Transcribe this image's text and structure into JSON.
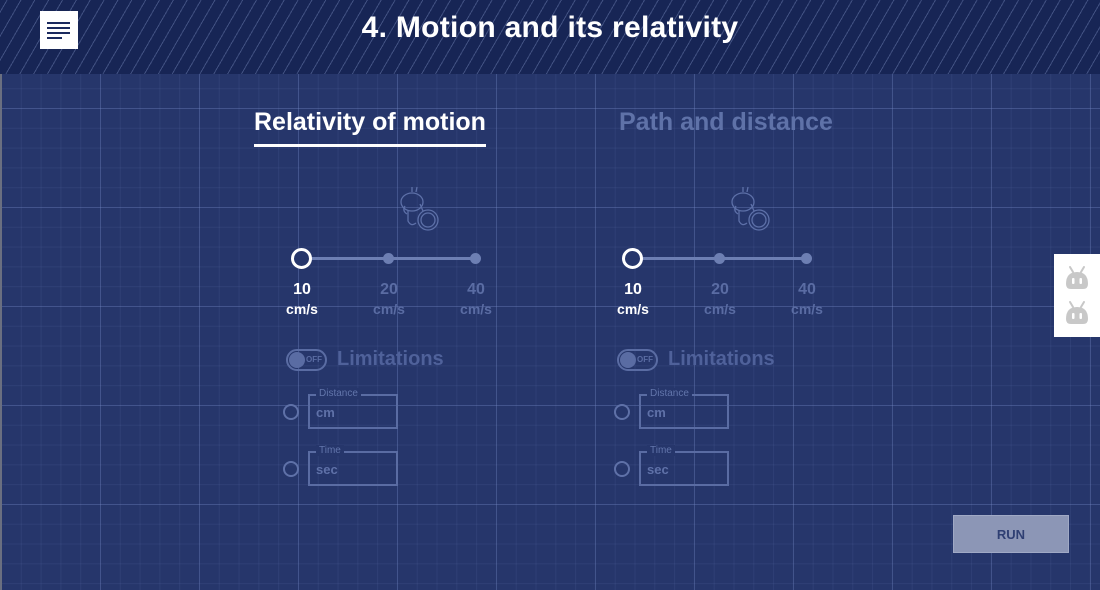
{
  "header": {
    "title": "4. Motion and its relativity",
    "menu_icon": "menu-lines-icon"
  },
  "tabs": [
    {
      "label": "Relativity of motion",
      "active": true
    },
    {
      "label": "Path and distance",
      "active": false
    }
  ],
  "panels": [
    {
      "robot_icon": "robot-icon",
      "speed_slider": {
        "stops": [
          {
            "value": "10",
            "unit": "cm/s"
          },
          {
            "value": "20",
            "unit": "cm/s"
          },
          {
            "value": "40",
            "unit": "cm/s"
          }
        ],
        "selected_index": 0
      },
      "limitations": {
        "label": "Limitations",
        "toggle_state": "OFF"
      },
      "fields": [
        {
          "legend": "Distance",
          "placeholder": "cm",
          "value": ""
        },
        {
          "legend": "Time",
          "placeholder": "sec",
          "value": ""
        }
      ]
    },
    {
      "robot_icon": "robot-icon",
      "speed_slider": {
        "stops": [
          {
            "value": "10",
            "unit": "cm/s"
          },
          {
            "value": "20",
            "unit": "cm/s"
          },
          {
            "value": "40",
            "unit": "cm/s"
          }
        ],
        "selected_index": 0
      },
      "limitations": {
        "label": "Limitations",
        "toggle_state": "OFF"
      },
      "fields": [
        {
          "legend": "Distance",
          "placeholder": "cm",
          "value": ""
        },
        {
          "legend": "Time",
          "placeholder": "sec",
          "value": ""
        }
      ]
    }
  ],
  "side_tools": [
    {
      "icon": "robot-head-icon"
    },
    {
      "icon": "robot-head-icon"
    }
  ],
  "run_button": {
    "label": "RUN"
  },
  "colors": {
    "background": "#26366b",
    "header": "#172555",
    "accent": "#ffffff",
    "disabled": "#5a6ca3"
  }
}
